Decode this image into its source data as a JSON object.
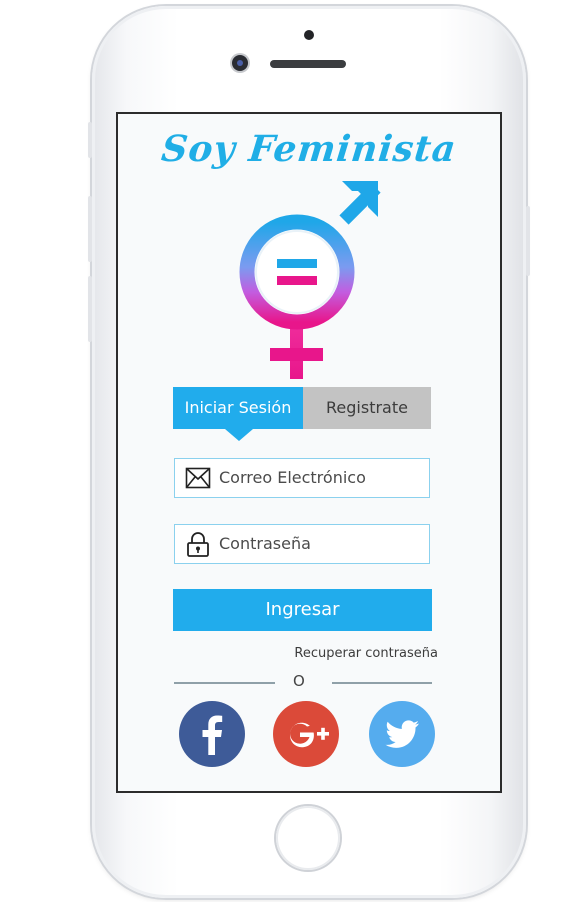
{
  "app": {
    "title": "Soy Feminista"
  },
  "tabs": {
    "login": "Iniciar Sesión",
    "register": "Registrate"
  },
  "form": {
    "email_placeholder": "Correo Electrónico",
    "password_placeholder": "Contraseña",
    "submit_label": "Ingresar",
    "recover_label": "Recuperar contraseña",
    "divider_label": "O"
  },
  "social": [
    {
      "name": "facebook",
      "icon": "facebook-icon",
      "color": "#3e5b98"
    },
    {
      "name": "google-plus",
      "icon": "google-plus-icon",
      "color": "#db4a39"
    },
    {
      "name": "twitter",
      "icon": "twitter-icon",
      "color": "#55acee"
    }
  ],
  "colors": {
    "accent": "#21acec",
    "title": "#20aee6",
    "logo_blue": "#1fa7e8",
    "logo_pink": "#e8168b",
    "tab_inactive": "#c3c3c3"
  }
}
